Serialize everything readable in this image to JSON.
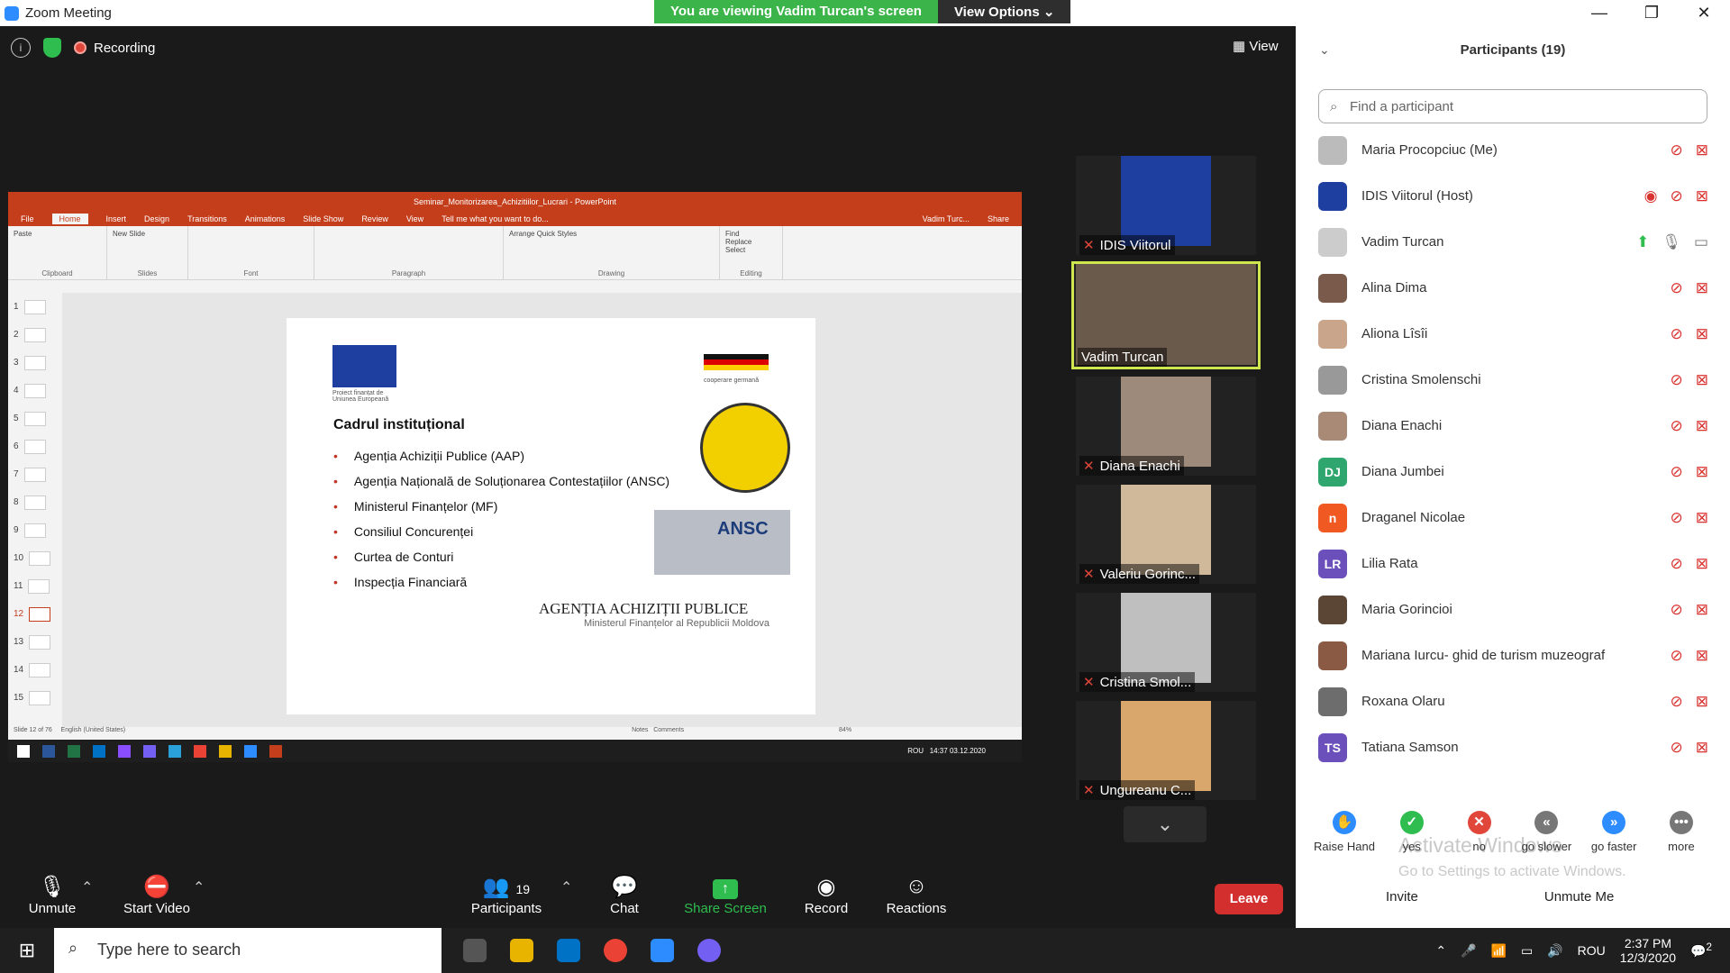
{
  "window": {
    "title": "Zoom Meeting",
    "min": "—",
    "max": "❐",
    "close": "✕"
  },
  "banner": {
    "message": "You are viewing Vadim Turcan's screen",
    "options": "View Options ⌄"
  },
  "status": {
    "recording": "Recording",
    "info_glyph": "i",
    "view_label": "View"
  },
  "shared_screen": {
    "pp_title": "Seminar_Monitorizarea_Achizitiilor_Lucrari - PowerPoint",
    "tabs": [
      "File",
      "Home",
      "Insert",
      "Design",
      "Transitions",
      "Animations",
      "Slide Show",
      "Review",
      "View"
    ],
    "tell_me": "Tell me what you want to do...",
    "user": "Vadim Turc...",
    "share": "Share",
    "ribbon_groups": [
      "Clipboard",
      "Slides",
      "Font",
      "Paragraph",
      "Drawing",
      "Editing"
    ],
    "ribbon_items": {
      "paste": "Paste",
      "new_slide": "New Slide",
      "find": "Find",
      "replace": "Replace",
      "select": "Select",
      "arrange": "Arrange",
      "quick_styles": "Quick Styles"
    },
    "thumb_numbers": [
      "1",
      "2",
      "3",
      "4",
      "5",
      "6",
      "7",
      "8",
      "9",
      "10",
      "11",
      "12",
      "13",
      "14",
      "15"
    ],
    "slide": {
      "eu_caption": "Proiect finanțat de Uniunea Europeană",
      "heading": "Cadrul instituțional",
      "bullets": [
        "Agenția Achiziții Publice (AAP)",
        "Agenția Națională de Soluționarea Contestațiilor (ANSC)",
        "Ministerul Finanțelor (MF)",
        "Consiliul Concurenței",
        "Curtea de Conturi",
        "Inspecția Financiară"
      ],
      "de_caption": "cooperare germană",
      "ansc": "ANSC",
      "aap_title": "AGENȚIA ACHIZIȚII PUBLICE",
      "aap_sub": "Ministerul Finanțelor al Republicii Moldova"
    },
    "status_left": "Slide 12 of 76",
    "status_lang": "English (United States)",
    "notes": "Notes",
    "comments": "Comments",
    "zoom_pct": "84%",
    "taskbar_time": "14:37",
    "taskbar_date": "03.12.2020",
    "taskbar_lang": "ROU"
  },
  "gallery": [
    {
      "name": "IDIS Viitorul",
      "active": false
    },
    {
      "name": "Vadim Turcan",
      "active": true
    },
    {
      "name": "Diana Enachi",
      "active": false
    },
    {
      "name": "Valeriu Gorinc...",
      "active": false
    },
    {
      "name": "Cristina Smol...",
      "active": false
    },
    {
      "name": "Ungureanu C...",
      "active": false
    }
  ],
  "participants": {
    "header": "Participants (19)",
    "search_placeholder": "Find a participant",
    "list": [
      {
        "name": "Maria Procopciuc (Me)",
        "initials": "",
        "color": "#bbbbbb"
      },
      {
        "name": "IDIS Viitorul (Host)",
        "initials": "",
        "color": "#1f3fa0"
      },
      {
        "name": "Vadim Turcan",
        "initials": "",
        "color": "#cccccc"
      },
      {
        "name": "Alina Dima",
        "initials": "",
        "color": "#7a5a4a"
      },
      {
        "name": "Aliona Lîsîi",
        "initials": "",
        "color": "#c9a58c"
      },
      {
        "name": "Cristina Smolenschi",
        "initials": "",
        "color": "#999999"
      },
      {
        "name": "Diana Enachi",
        "initials": "",
        "color": "#a88a77"
      },
      {
        "name": "Diana Jumbei",
        "initials": "DJ",
        "color": "#2fa66e"
      },
      {
        "name": "Draganel Nicolae",
        "initials": "n",
        "color": "#f05a22"
      },
      {
        "name": "Lilia Rata",
        "initials": "LR",
        "color": "#6b4fbb"
      },
      {
        "name": "Maria Gorincioi",
        "initials": "",
        "color": "#5b4636"
      },
      {
        "name": "Mariana Iurcu- ghid de turism muzeograf",
        "initials": "",
        "color": "#8a5a44"
      },
      {
        "name": "Roxana Olaru",
        "initials": "",
        "color": "#6d6d6d"
      },
      {
        "name": "Tatiana Samson",
        "initials": "TS",
        "color": "#6b4fbb"
      }
    ],
    "reactions": [
      {
        "label": "Raise Hand",
        "glyph": "✋",
        "color": "#2d8cff"
      },
      {
        "label": "yes",
        "glyph": "✓",
        "color": "#2ebd4e"
      },
      {
        "label": "no",
        "glyph": "✕",
        "color": "#e0473a"
      },
      {
        "label": "go slower",
        "glyph": "«",
        "color": "#777777"
      },
      {
        "label": "go faster",
        "glyph": "»",
        "color": "#2d8cff"
      },
      {
        "label": "more",
        "glyph": "•••",
        "color": "#777777"
      }
    ],
    "invite": "Invite",
    "unmute_me": "Unmute Me",
    "activate_title": "Activate Windows",
    "activate_sub": "Go to Settings to activate Windows."
  },
  "toolbar": {
    "unmute": "Unmute",
    "start_video": "Start Video",
    "participants": "Participants",
    "participant_count": "19",
    "chat": "Chat",
    "share_screen": "Share Screen",
    "record": "Record",
    "reactions": "Reactions",
    "leave": "Leave"
  },
  "taskbar": {
    "search_placeholder": "Type here to search",
    "lang": "ROU",
    "time": "2:37 PM",
    "date": "12/3/2020",
    "notif": "2"
  },
  "colors": {
    "zoom_blue": "#2d8cff",
    "green": "#3bb54a",
    "red": "#d32f2f",
    "powerpoint": "#c43e1c"
  }
}
